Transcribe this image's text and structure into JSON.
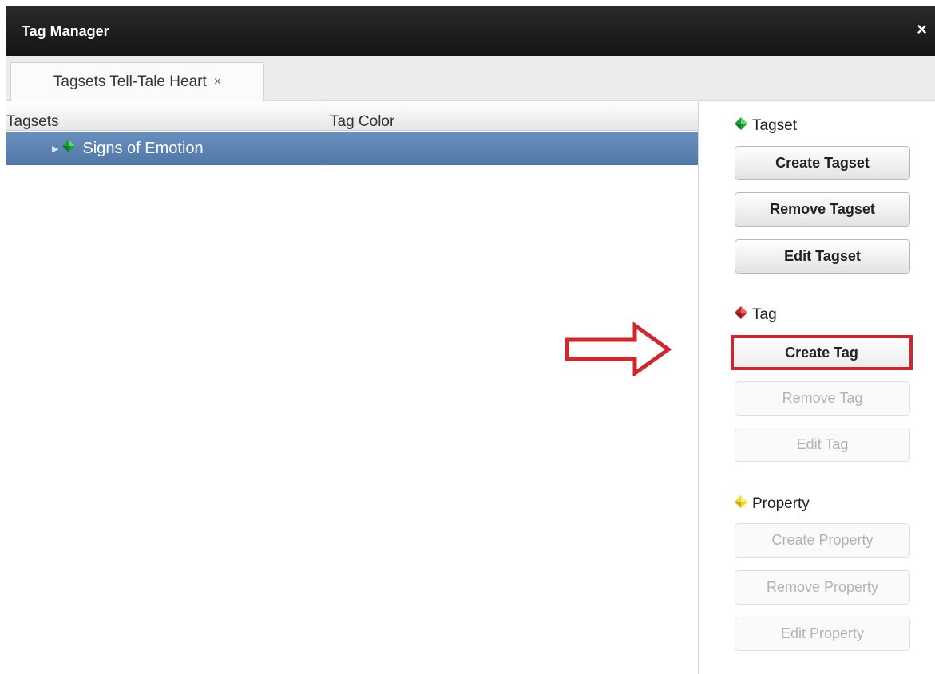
{
  "window": {
    "title": "Tag Manager",
    "close_glyph": "×"
  },
  "tabs": [
    {
      "label": "Tagsets Tell-Tale Heart",
      "close_glyph": "×"
    }
  ],
  "tree": {
    "columns": [
      "Tagsets",
      "Tag Color"
    ],
    "rows": [
      {
        "label": "Signs of Emotion",
        "icon": "green-gem-icon",
        "expander": "▶",
        "selected": true
      }
    ]
  },
  "panel": {
    "tagset": {
      "label": "Tagset",
      "icon_color": "#1e9e3a",
      "buttons": [
        {
          "label": "Create Tagset",
          "enabled": true
        },
        {
          "label": "Remove Tagset",
          "enabled": true
        },
        {
          "label": "Edit Tagset",
          "enabled": true
        }
      ]
    },
    "tag": {
      "label": "Tag",
      "icon_color": "#c0242a",
      "buttons": [
        {
          "label": "Create Tag",
          "enabled": true,
          "highlighted": true
        },
        {
          "label": "Remove Tag",
          "enabled": false
        },
        {
          "label": "Edit Tag",
          "enabled": false
        }
      ]
    },
    "property": {
      "label": "Property",
      "icon_color": "#f2d51d",
      "buttons": [
        {
          "label": "Create Property",
          "enabled": false
        },
        {
          "label": "Remove Property",
          "enabled": false
        },
        {
          "label": "Edit Property",
          "enabled": false
        }
      ]
    }
  },
  "colors": {
    "selection": "#5a80ae",
    "highlight_red": "#d0262c",
    "titlebar": "#1c1c1c"
  }
}
